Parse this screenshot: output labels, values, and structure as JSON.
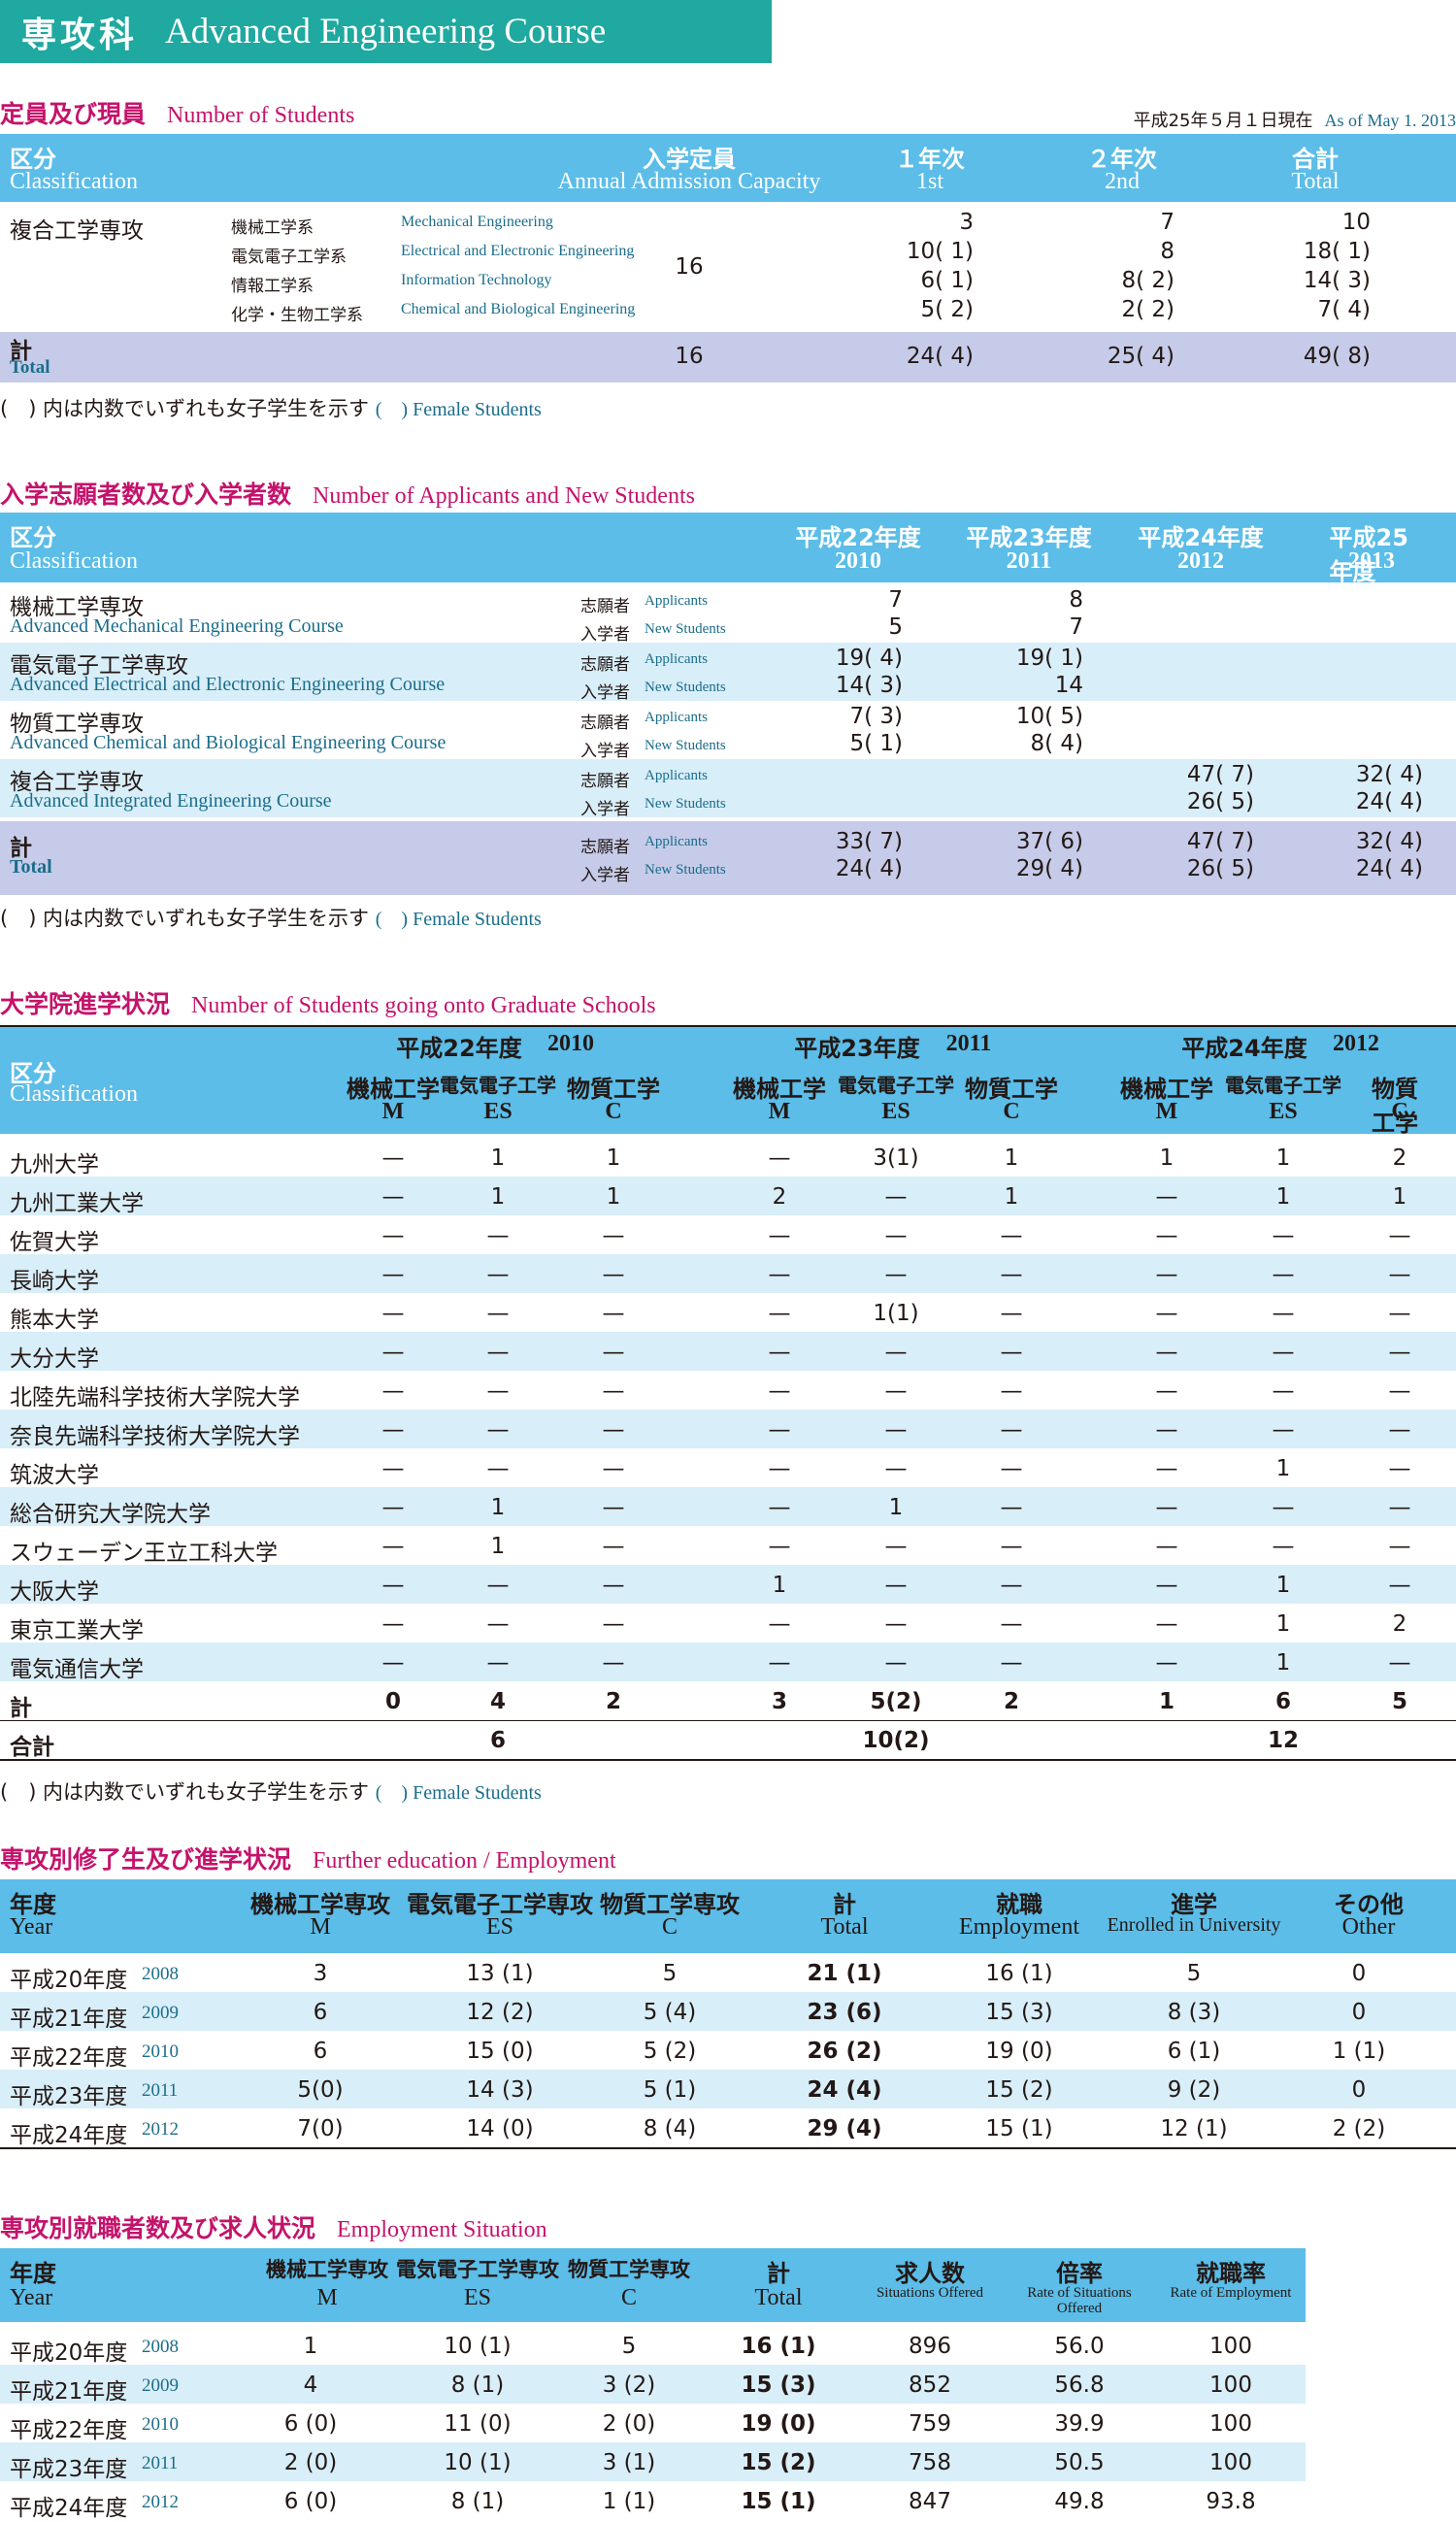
{
  "banner": {
    "jp": "専攻科",
    "en": "Advanced Engineering Course"
  },
  "s1": {
    "title_jp": "定員及び現員",
    "title_en": "Number of Students",
    "asof_jp": "平成25年５月１日現在",
    "asof_en": "As of May 1. 2013",
    "headers": {
      "class_jp": "区分",
      "class_en": "Classification",
      "cap_jp": "入学定員",
      "cap_en": "Annual Admission Capacity",
      "y1_jp": "１年次",
      "y1_en": "1st",
      "y2_jp": "２年次",
      "y2_en": "2nd",
      "tot_jp": "合計",
      "tot_en": "Total"
    },
    "course": "複合工学専攻",
    "capacity": "16",
    "rows": [
      {
        "jp": "機械工学系",
        "en": "Mechanical Engineering",
        "y1": "3",
        "y2": "7",
        "tot": "10"
      },
      {
        "jp": "電気電子工学系",
        "en": "Electrical and Electronic Engineering",
        "y1": "10(  1)",
        "y2": "8",
        "tot": "18(  1)"
      },
      {
        "jp": "情報工学系",
        "en": "Information Technology",
        "y1": "6(  1)",
        "y2": "8(  2)",
        "tot": "14(  3)"
      },
      {
        "jp": "化学・生物工学系",
        "en": "Chemical and Biological Engineering",
        "y1": "5(  2)",
        "y2": "2(  2)",
        "tot": "7(  4)"
      }
    ],
    "total": {
      "jp": "計",
      "en": "Total",
      "cap": "16",
      "y1": "24(  4)",
      "y2": "25(  4)",
      "tot": "49(  8)"
    },
    "note_jp": "(　) 内は内数でいずれも女子学生を示す",
    "note_en": "(　) Female Students"
  },
  "s2": {
    "title_jp": "入学志願者数及び入学者数",
    "title_en": "Number of Applicants and New Students",
    "headers": {
      "class_jp": "区分",
      "class_en": "Classification",
      "years": [
        {
          "jp": "平成22年度",
          "en": "2010"
        },
        {
          "jp": "平成23年度",
          "en": "2011"
        },
        {
          "jp": "平成24年度",
          "en": "2012"
        },
        {
          "jp": "平成25年度",
          "en": "2013"
        }
      ]
    },
    "app_jp": "志願者",
    "app_en": "Applicants",
    "new_jp": "入学者",
    "new_en": "New Students",
    "courses": [
      {
        "jp": "機械工学専攻",
        "en": "Advanced Mechanical Engineering Course",
        "app": [
          "7",
          "8",
          "",
          ""
        ],
        "new": [
          "5",
          "7",
          "",
          ""
        ]
      },
      {
        "jp": "電気電子工学専攻",
        "en": "Advanced Electrical and Electronic Engineering Course",
        "app": [
          "19(  4)",
          "19(  1)",
          "",
          ""
        ],
        "new": [
          "14(  3)",
          "14",
          "",
          ""
        ]
      },
      {
        "jp": "物質工学専攻",
        "en": "Advanced Chemical and Biological Engineering Course",
        "app": [
          "7(  3)",
          "10(  5)",
          "",
          ""
        ],
        "new": [
          "5(  1)",
          "8(  4)",
          "",
          ""
        ]
      },
      {
        "jp": "複合工学専攻",
        "en": "Advanced Integrated Engineering Course",
        "app": [
          "",
          "",
          "47(  7)",
          "32(  4)"
        ],
        "new": [
          "",
          "",
          "26(  5)",
          "24(  4)"
        ]
      }
    ],
    "total": {
      "jp": "計",
      "en": "Total",
      "app": [
        "33(  7)",
        "37(  6)",
        "47(  7)",
        "32(  4)"
      ],
      "new": [
        "24(  4)",
        "29(  4)",
        "26(  5)",
        "24(  4)"
      ]
    },
    "note_jp": "(　) 内は内数でいずれも女子学生を示す",
    "note_en": "(　) Female Students"
  },
  "s3": {
    "title_jp": "大学院進学状況",
    "title_en": "Number of Students going onto Graduate Schools",
    "headers": {
      "class_jp": "区分",
      "class_en": "Classification",
      "years": [
        {
          "jp": "平成22年度",
          "en": "2010"
        },
        {
          "jp": "平成23年度",
          "en": "2011"
        },
        {
          "jp": "平成24年度",
          "en": "2012"
        }
      ],
      "depts": [
        {
          "jp": "機械工学",
          "en": "M"
        },
        {
          "jp": "電気電子工学",
          "en": "ES"
        },
        {
          "jp": "物質工学",
          "en": "C"
        }
      ]
    },
    "rows": [
      {
        "name": "九州大学",
        "v": [
          "—",
          "1",
          "1",
          "—",
          "3(1)",
          "1",
          "1",
          "1",
          "2"
        ]
      },
      {
        "name": "九州工業大学",
        "v": [
          "—",
          "1",
          "1",
          "2",
          "—",
          "1",
          "—",
          "1",
          "1"
        ]
      },
      {
        "name": "佐賀大学",
        "v": [
          "—",
          "—",
          "—",
          "—",
          "—",
          "—",
          "—",
          "—",
          "—"
        ]
      },
      {
        "name": "長崎大学",
        "v": [
          "—",
          "—",
          "—",
          "—",
          "—",
          "—",
          "—",
          "—",
          "—"
        ]
      },
      {
        "name": "熊本大学",
        "v": [
          "—",
          "—",
          "—",
          "—",
          "1(1)",
          "—",
          "—",
          "—",
          "—"
        ]
      },
      {
        "name": "大分大学",
        "v": [
          "—",
          "—",
          "—",
          "—",
          "—",
          "—",
          "—",
          "—",
          "—"
        ]
      },
      {
        "name": "北陸先端科学技術大学院大学",
        "v": [
          "—",
          "—",
          "—",
          "—",
          "—",
          "—",
          "—",
          "—",
          "—"
        ]
      },
      {
        "name": "奈良先端科学技術大学院大学",
        "v": [
          "—",
          "—",
          "—",
          "—",
          "—",
          "—",
          "—",
          "—",
          "—"
        ]
      },
      {
        "name": "筑波大学",
        "v": [
          "—",
          "—",
          "—",
          "—",
          "—",
          "—",
          "—",
          "1",
          "—"
        ]
      },
      {
        "name": "総合研究大学院大学",
        "v": [
          "—",
          "1",
          "—",
          "—",
          "1",
          "—",
          "—",
          "—",
          "—"
        ]
      },
      {
        "name": "スウェーデン王立工科大学",
        "v": [
          "—",
          "1",
          "—",
          "—",
          "—",
          "—",
          "—",
          "—",
          "—"
        ]
      },
      {
        "name": "大阪大学",
        "v": [
          "—",
          "—",
          "—",
          "1",
          "—",
          "—",
          "—",
          "1",
          "—"
        ]
      },
      {
        "name": "東京工業大学",
        "v": [
          "—",
          "—",
          "—",
          "—",
          "—",
          "—",
          "—",
          "1",
          "2"
        ]
      },
      {
        "name": "電気通信大学",
        "v": [
          "—",
          "—",
          "—",
          "—",
          "—",
          "—",
          "—",
          "1",
          "—"
        ]
      }
    ],
    "subtotal": {
      "name": "計",
      "v": [
        "0",
        "4",
        "2",
        "3",
        "5(2)",
        "2",
        "1",
        "6",
        "5"
      ]
    },
    "grand": {
      "name": "合計",
      "v": [
        "6",
        "10(2)",
        "12"
      ]
    },
    "note_jp": "(　) 内は内数でいずれも女子学生を示す",
    "note_en": "(　) Female Students"
  },
  "s4": {
    "title_jp": "専攻別修了生及び進学状況",
    "title_en": "Further education / Employment",
    "headers": [
      {
        "jp": "年度",
        "en": "Year"
      },
      {
        "jp": "機械工学専攻",
        "en": "M"
      },
      {
        "jp": "電気電子工学専攻",
        "en": "ES"
      },
      {
        "jp": "物質工学専攻",
        "en": "C"
      },
      {
        "jp": "計",
        "en": "Total"
      },
      {
        "jp": "就職",
        "en": "Employment"
      },
      {
        "jp": "進学",
        "en": "Enrolled in University"
      },
      {
        "jp": "その他",
        "en": "Other"
      }
    ],
    "rows": [
      {
        "jp": "平成20年度",
        "en": "2008",
        "v": [
          "3",
          "13 (1)",
          "5",
          "21 (1)",
          "16 (1)",
          "5",
          "0"
        ]
      },
      {
        "jp": "平成21年度",
        "en": "2009",
        "v": [
          "6",
          "12 (2)",
          "5 (4)",
          "23 (6)",
          "15 (3)",
          "8 (3)",
          "0"
        ]
      },
      {
        "jp": "平成22年度",
        "en": "2010",
        "v": [
          "6",
          "15 (0)",
          "5 (2)",
          "26 (2)",
          "19 (0)",
          "6 (1)",
          "1 (1)"
        ]
      },
      {
        "jp": "平成23年度",
        "en": "2011",
        "v": [
          "5(0)",
          "14 (3)",
          "5 (1)",
          "24 (4)",
          "15 (2)",
          "9 (2)",
          "0"
        ]
      },
      {
        "jp": "平成24年度",
        "en": "2012",
        "v": [
          "7(0)",
          "14 (0)",
          "8 (4)",
          "29 (4)",
          "15 (1)",
          "12 (1)",
          "2 (2)"
        ]
      }
    ]
  },
  "s5": {
    "title_jp": "専攻別就職者数及び求人状況",
    "title_en": "Employment Situation",
    "headers": [
      {
        "jp": "年度",
        "en": "Year"
      },
      {
        "jp": "機械工学専攻",
        "en": "M"
      },
      {
        "jp": "電気電子工学専攻",
        "en": "ES"
      },
      {
        "jp": "物質工学専攻",
        "en": "C"
      },
      {
        "jp": "計",
        "en": "Total"
      },
      {
        "jp": "求人数",
        "en": "Situations Offered"
      },
      {
        "jp": "倍率",
        "en": "Rate of Situations Offered"
      },
      {
        "jp": "就職率",
        "en": "Rate of Employment"
      }
    ],
    "rows": [
      {
        "jp": "平成20年度",
        "en": "2008",
        "v": [
          "1",
          "10 (1)",
          "5",
          "16 (1)",
          "896",
          "56.0",
          "100"
        ]
      },
      {
        "jp": "平成21年度",
        "en": "2009",
        "v": [
          "4",
          "8 (1)",
          "3 (2)",
          "15 (3)",
          "852",
          "56.8",
          "100"
        ]
      },
      {
        "jp": "平成22年度",
        "en": "2010",
        "v": [
          "6 (0)",
          "11 (0)",
          "2 (0)",
          "19 (0)",
          "759",
          "39.9",
          "100"
        ]
      },
      {
        "jp": "平成23年度",
        "en": "2011",
        "v": [
          "2 (0)",
          "10 (1)",
          "3 (1)",
          "15 (2)",
          "758",
          "50.5",
          "100"
        ]
      },
      {
        "jp": "平成24年度",
        "en": "2012",
        "v": [
          "6 (0)",
          "8 (1)",
          "1 (1)",
          "15 (1)",
          "847",
          "49.8",
          "93.8"
        ]
      }
    ]
  }
}
